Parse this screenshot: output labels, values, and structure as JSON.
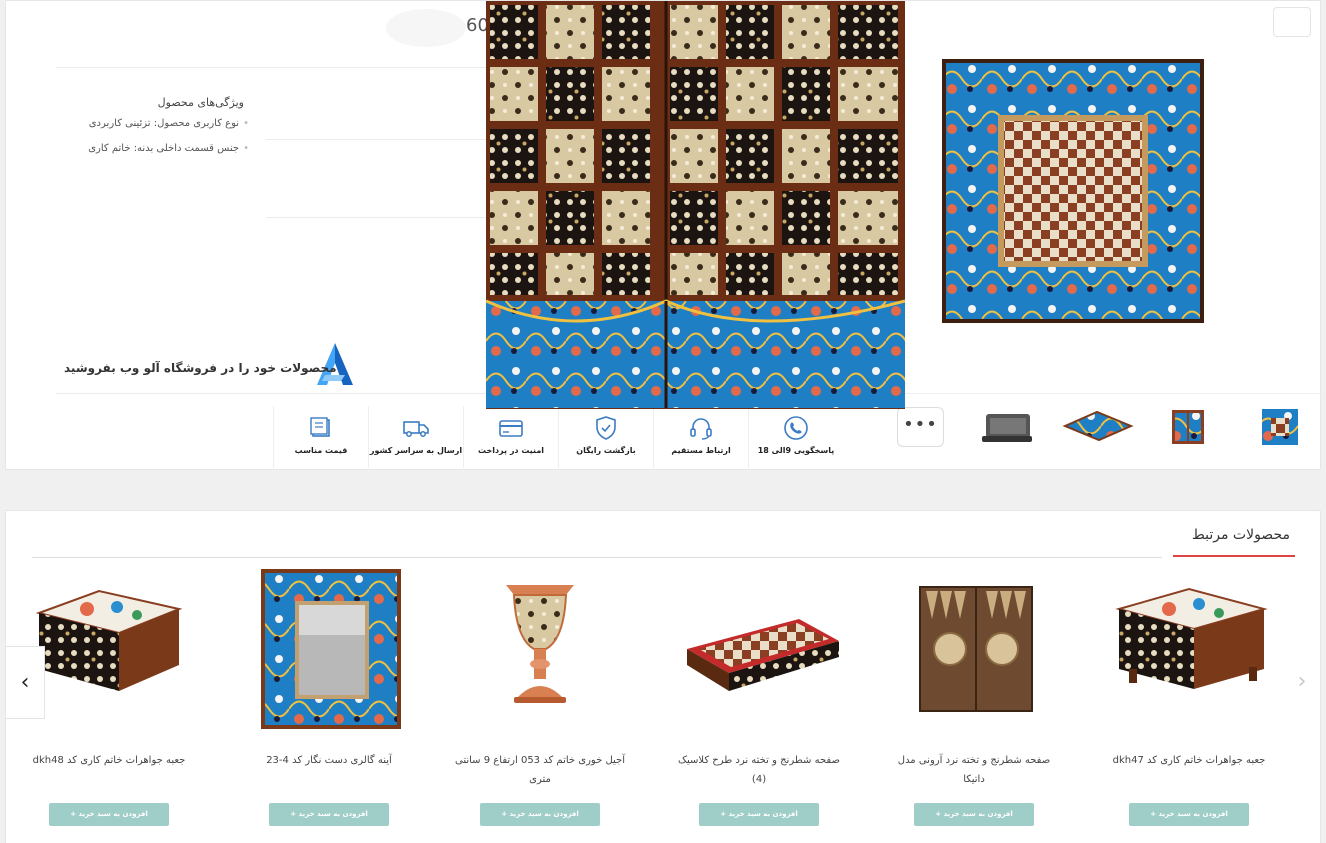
{
  "product": {
    "price_fragment": "60",
    "features_title": "ویژگی‌های محصول",
    "features": [
      "نوع کاربری محصول: تزئینی کاربردی",
      "جنس قسمت داخلی بدنه: خاتم کاری"
    ]
  },
  "promo": {
    "text": "محصولات خود را در فروشگاه آلو وب بفروشید"
  },
  "services": [
    {
      "label": "پاسخگویی 9الی 18",
      "icon": "phone-support-icon"
    },
    {
      "label": "ارتباط مستقیم",
      "icon": "headset-icon"
    },
    {
      "label": "بازگشت رایگان",
      "icon": "shield-check-icon"
    },
    {
      "label": "امنیت در پرداخت",
      "icon": "credit-card-icon"
    },
    {
      "label": "ارسال به سراسر کشور",
      "icon": "truck-icon"
    },
    {
      "label": "قیمت مناسب",
      "icon": "price-tag-icon"
    }
  ],
  "gallery": {
    "more_label": "•••"
  },
  "related": {
    "title": "محصولات مرتبط",
    "prev_arrow": "‹",
    "next_arrow": "›",
    "add_to_cart": "افزودن به سبد خرید +",
    "products": [
      {
        "name": "جعبه جواهرات خاتم کاری کد dkh47"
      },
      {
        "name": "صفحه شطرنج و تخته نرد آرونی مدل داتیکا"
      },
      {
        "name": "صفحه شطرنج و تخته نرد طرح کلاسیک (4)"
      },
      {
        "name": "آجیل خوری خاتم کد 053 ارتفاع 9 سانتی متری"
      },
      {
        "name": "آینه گالری دست نگار کد 4-23"
      },
      {
        "name": "جعبه جواهرات خاتم کاری کد dkh48"
      }
    ]
  },
  "colors": {
    "accent_red": "#e04545",
    "cart_button": "#9fcec9",
    "khatam_brown": "#7a3a1a",
    "mina_blue": "#2a8fd0"
  }
}
